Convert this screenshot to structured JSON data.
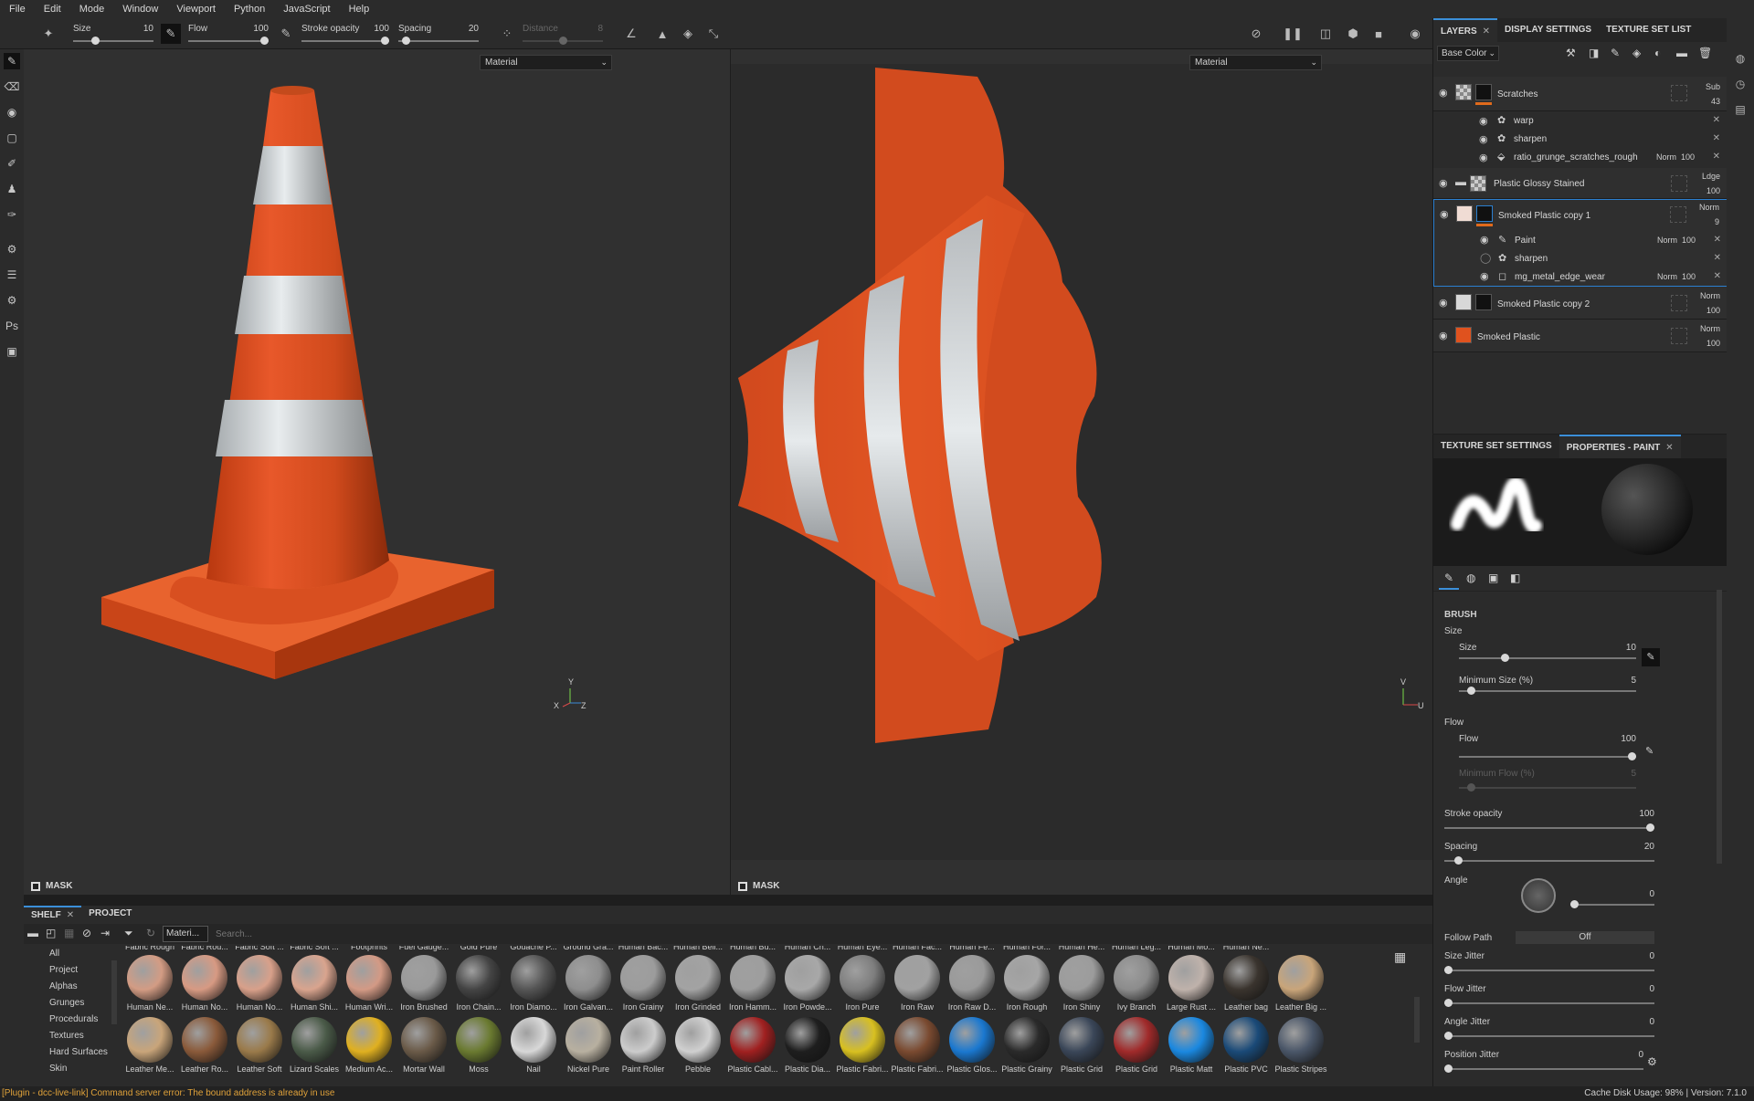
{
  "menu": [
    "File",
    "Edit",
    "Mode",
    "Window",
    "Viewport",
    "Python",
    "JavaScript",
    "Help"
  ],
  "toolbar": {
    "size": {
      "label": "Size",
      "value": "10",
      "level": 0.25
    },
    "flow": {
      "label": "Flow",
      "value": "100",
      "level": 1.0
    },
    "stroke_opacity": {
      "label": "Stroke opacity",
      "value": "100",
      "level": 1.0
    },
    "spacing": {
      "label": "Spacing",
      "value": "20",
      "level": 0.05
    },
    "distance": {
      "label": "Distance",
      "value": "8",
      "level": 0.5
    }
  },
  "viewports": {
    "left": {
      "material_select": "Material",
      "mask_label": "MASK",
      "axis": {
        "y": "Y",
        "x": "X",
        "z": "Z"
      }
    },
    "right": {
      "material_select": "Material",
      "mask_label": "MASK",
      "axis": {
        "v": "V",
        "u": "U"
      }
    }
  },
  "layers_panel": {
    "tabs": [
      {
        "label": "LAYERS",
        "active": true,
        "closable": true
      },
      {
        "label": "DISPLAY SETTINGS",
        "active": false
      },
      {
        "label": "TEXTURE SET LIST",
        "active": false
      }
    ],
    "channel_select": "Base Color",
    "layers": [
      {
        "name": "Scratches",
        "blend": "Sub",
        "opacity": "43",
        "effects": [
          {
            "name": "warp",
            "blend": "",
            "opacity": ""
          },
          {
            "name": "sharpen",
            "blend": "",
            "opacity": ""
          },
          {
            "name": "ratio_grunge_scratches_rough",
            "blend": "Norm",
            "opacity": "100"
          }
        ]
      },
      {
        "name": "Plastic Glossy Stained",
        "blend": "Ldge",
        "opacity": "100",
        "effects": []
      },
      {
        "name": "Smoked Plastic copy 1",
        "blend": "Norm",
        "opacity": "9",
        "selected": true,
        "effects": [
          {
            "name": "Paint",
            "blend": "Norm",
            "opacity": "100"
          },
          {
            "name": "sharpen",
            "blend": "",
            "opacity": ""
          },
          {
            "name": "mg_metal_edge_wear",
            "blend": "Norm",
            "opacity": "100"
          }
        ]
      },
      {
        "name": "Smoked Plastic copy 2",
        "blend": "Norm",
        "opacity": "100",
        "effects": []
      },
      {
        "name": "Smoked Plastic",
        "blend": "Norm",
        "opacity": "100",
        "effects": []
      }
    ]
  },
  "properties_panel": {
    "tabs": [
      {
        "label": "TEXTURE SET SETTINGS",
        "active": false
      },
      {
        "label": "PROPERTIES - PAINT",
        "active": true,
        "closable": true
      }
    ],
    "section": "BRUSH",
    "size_group": "Size",
    "size": {
      "label": "Size",
      "value": "10",
      "level": 0.25
    },
    "min_size": {
      "label": "Minimum Size (%)",
      "value": "5",
      "level": 0.05
    },
    "flow_group": "Flow",
    "flow": {
      "label": "Flow",
      "value": "100",
      "level": 1.0
    },
    "min_flow": {
      "label": "Minimum Flow (%)",
      "value": "5",
      "level": 0.05
    },
    "stroke_opacity": {
      "label": "Stroke opacity",
      "value": "100",
      "level": 1.0
    },
    "spacing": {
      "label": "Spacing",
      "value": "20",
      "level": 0.05
    },
    "angle": {
      "label": "Angle",
      "value": "0",
      "level": 0.0
    },
    "follow_path": {
      "label": "Follow Path",
      "value": "Off"
    },
    "size_jitter": {
      "label": "Size Jitter",
      "value": "0",
      "level": 0.0
    },
    "flow_jitter": {
      "label": "Flow Jitter",
      "value": "0",
      "level": 0.0
    },
    "angle_jitter": {
      "label": "Angle Jitter",
      "value": "0",
      "level": 0.0
    },
    "position_jitter": {
      "label": "Position Jitter",
      "value": "0",
      "level": 0.0
    }
  },
  "shelf": {
    "tabs": [
      {
        "label": "SHELF",
        "active": true,
        "closable": true
      },
      {
        "label": "PROJECT",
        "active": false
      }
    ],
    "filter_chip": "Materi...",
    "search_placeholder": "Search...",
    "categories": [
      "All",
      "Project",
      "Alphas",
      "Grunges",
      "Procedurals",
      "Textures",
      "Hard Surfaces",
      "Skin"
    ],
    "top_labels": [
      "Fabric Rough",
      "Fabric Rou...",
      "Fabric Soft ...",
      "Fabric Soft ...",
      "Footprints",
      "Fuel Gauge...",
      "Gold Pure",
      "Gouache P...",
      "Ground Gra...",
      "Human Bac...",
      "Human Beli...",
      "Human Bu...",
      "Human Ch...",
      "Human Eye...",
      "Human Fac...",
      "Human Fe...",
      "Human For...",
      "Human He...",
      "Human Leg...",
      "Human Mo...",
      "Human Ne..."
    ],
    "row1": [
      {
        "label": "Human Ne...",
        "color": "#d39c84"
      },
      {
        "label": "Human No...",
        "color": "#d79a83"
      },
      {
        "label": "Human No...",
        "color": "#d8a08a"
      },
      {
        "label": "Human Shi...",
        "color": "#d9a48e"
      },
      {
        "label": "Human Wri...",
        "color": "#d39a85"
      },
      {
        "label": "Iron Brushed",
        "color": "#9a9a9a"
      },
      {
        "label": "Iron Chain...",
        "color": "#444444"
      },
      {
        "label": "Iron Diamo...",
        "color": "#555555"
      },
      {
        "label": "Iron Galvan...",
        "color": "#8e8e8e"
      },
      {
        "label": "Iron Grainy",
        "color": "#9c9c9c"
      },
      {
        "label": "Iron Grinded",
        "color": "#a3a3a3"
      },
      {
        "label": "Iron Hamm...",
        "color": "#9e9e9e"
      },
      {
        "label": "Iron Powde...",
        "color": "#a8a8a8"
      },
      {
        "label": "Iron Pure",
        "color": "#7e7e7e"
      },
      {
        "label": "Iron Raw",
        "color": "#a1a1a1"
      },
      {
        "label": "Iron Raw D...",
        "color": "#9a9a9a"
      },
      {
        "label": "Iron Rough",
        "color": "#a6a6a6"
      },
      {
        "label": "Iron Shiny",
        "color": "#9c9c9c"
      },
      {
        "label": "Ivy Branch",
        "color": "#8c8c8c"
      },
      {
        "label": "Large Rust ...",
        "color": "#bfb2ab"
      },
      {
        "label": "Leather bag",
        "color": "#3a342e"
      },
      {
        "label": "Leather Big ...",
        "color": "#c9a57a"
      }
    ],
    "row2": [
      {
        "label": "Leather Me...",
        "color": "#c9a57a"
      },
      {
        "label": "Leather Ro...",
        "color": "#8a5a3a"
      },
      {
        "label": "Leather Soft",
        "color": "#9a7a4a"
      },
      {
        "label": "Lizard Scales",
        "color": "#4a5a48"
      },
      {
        "label": "Medium Ac...",
        "color": "#e0b020"
      },
      {
        "label": "Mortar Wall",
        "color": "#6a5a48"
      },
      {
        "label": "Moss",
        "color": "#6a7a30"
      },
      {
        "label": "Nail",
        "color": "#d8d8d8"
      },
      {
        "label": "Nickel Pure",
        "color": "#b8b0a0"
      },
      {
        "label": "Paint Roller",
        "color": "#cccccc"
      },
      {
        "label": "Pebble",
        "color": "#d0d0d0"
      },
      {
        "label": "Plastic Cabl...",
        "color": "#a02020"
      },
      {
        "label": "Plastic Dia...",
        "color": "#1e1e1e"
      },
      {
        "label": "Plastic Fabri...",
        "color": "#d8c020"
      },
      {
        "label": "Plastic Fabri...",
        "color": "#7a4a30"
      },
      {
        "label": "Plastic Glos...",
        "color": "#1a78d0"
      },
      {
        "label": "Plastic Grainy",
        "color": "#2a2a2a"
      },
      {
        "label": "Plastic Grid",
        "color": "#3a4658"
      },
      {
        "label": "Plastic Grid",
        "color": "#a02a2a"
      },
      {
        "label": "Plastic Matt",
        "color": "#1a88e0"
      },
      {
        "label": "Plastic PVC",
        "color": "#1a4a78"
      },
      {
        "label": "Plastic Stripes",
        "color": "#4a5668"
      }
    ]
  },
  "status": {
    "error": "[Plugin - dcc-live-link] Command server error: The bound address is already in use",
    "right": "Cache Disk Usage:   98% | Version: 7.1.0"
  },
  "colors": {
    "accent": "#3b8fd9",
    "cone_orange": "#e0521e",
    "stripe": "#d8dde0"
  }
}
